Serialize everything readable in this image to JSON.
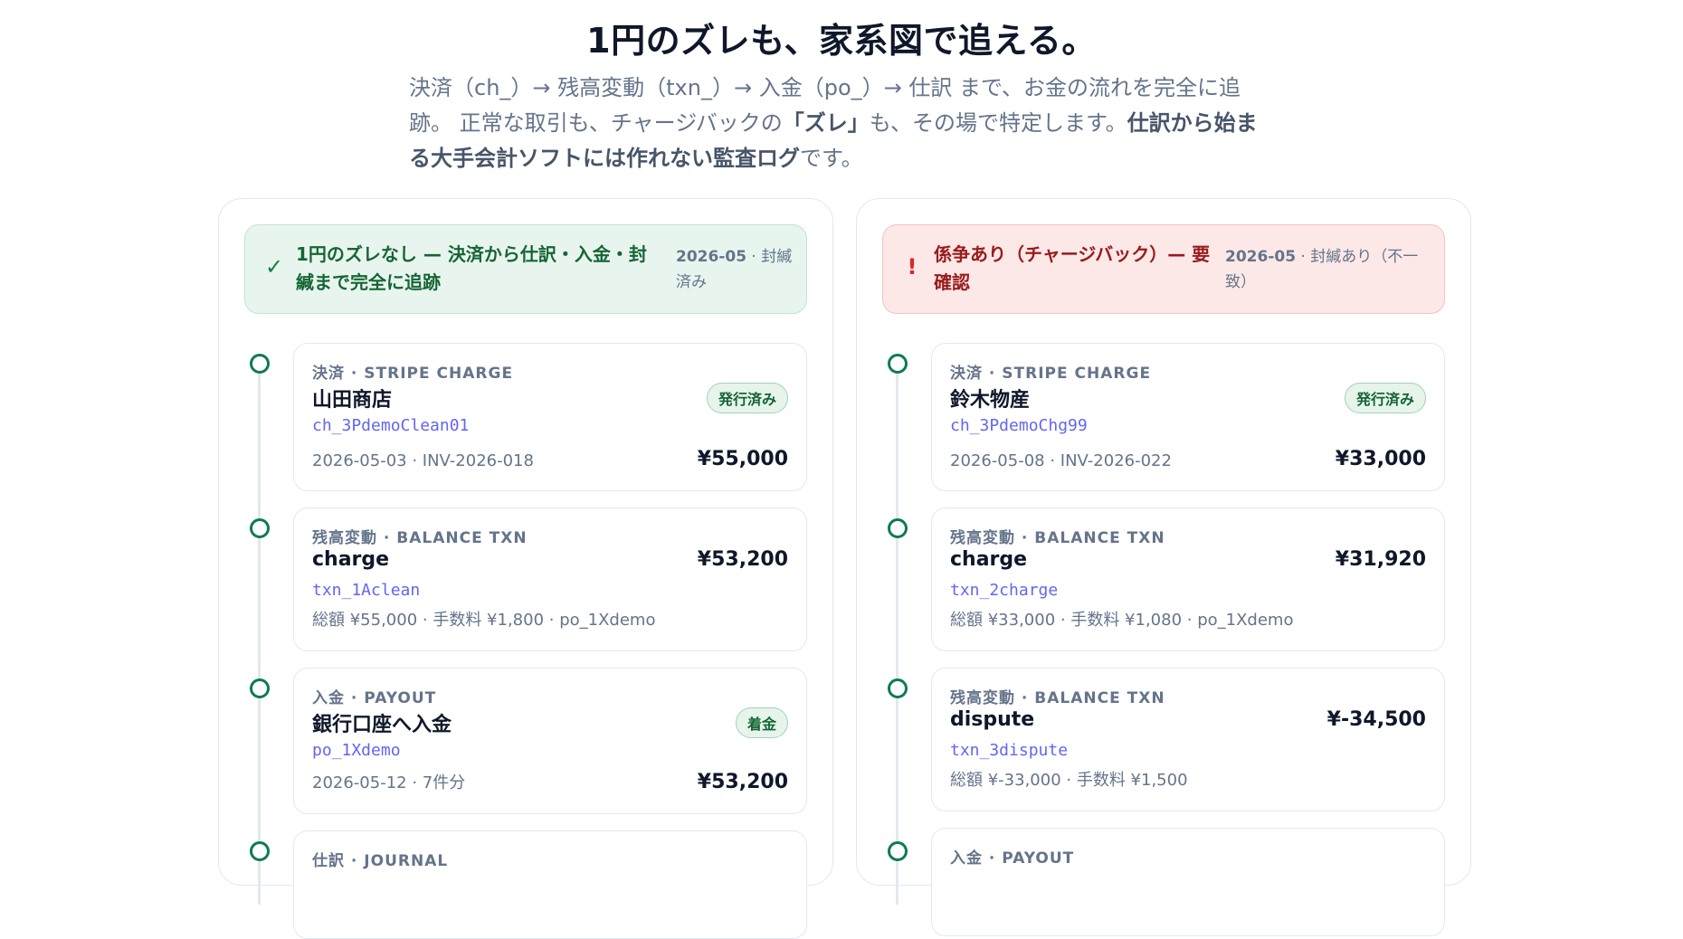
{
  "hero": {
    "title": "1円のズレも、家系図で追える。",
    "lead_1": "決済（ch_）→ 残高変動（txn_）→ 入金（po_）→ 仕訳 まで、お金の流れを完全に追跡。 正常な取引も、チャージバックの",
    "lead_2": "「ズレ」",
    "lead_3": "も、その場で特定します。",
    "lead_4": "仕訳から始まる大手会計ソフトには作れない監査ログ",
    "lead_5": "です。"
  },
  "colors": {
    "ok": "#166534",
    "bad": "#991b1b",
    "ref": "#6366f1",
    "dot": "#0f7a55"
  },
  "left": {
    "status_icon": "✓",
    "status_text": "1円のズレなし — 決済から仕訳・入金・封緘まで完全に追跡",
    "status_month": "2026-05",
    "status_state": " · 封緘済み",
    "cards": [
      {
        "kind": "決済 · STRIPE CHARGE",
        "name": "山田商店",
        "ref": "ch_3PdemoClean01",
        "sub": "2026-05-03 · INV-2026-018",
        "amount": "¥55,000",
        "badge": "発行済み"
      },
      {
        "kind": "残高変動 · BALANCE TXN",
        "name": "charge",
        "ref": "txn_1Aclean",
        "sub": "総額 ¥55,000 · 手数料 ¥1,800 · po_1Xdemo",
        "amount": "¥53,200"
      },
      {
        "kind": "入金 · PAYOUT",
        "name": "銀行口座へ入金",
        "ref": "po_1Xdemo",
        "sub": "2026-05-12 · 7件分",
        "amount": "¥53,200",
        "badge": "着金"
      },
      {
        "kind": "仕訳 · JOURNAL"
      }
    ]
  },
  "right": {
    "status_icon": "!",
    "status_text": "係争あり（チャージバック）— 要確認",
    "status_month": "2026-05",
    "status_state": " · 封緘あり（不一致）",
    "cards": [
      {
        "kind": "決済 · STRIPE CHARGE",
        "name": "鈴木物産",
        "ref": "ch_3PdemoChg99",
        "sub": "2026-05-08 · INV-2026-022",
        "amount": "¥33,000",
        "badge": "発行済み"
      },
      {
        "kind": "残高変動 · BALANCE TXN",
        "name": "charge",
        "ref": "txn_2charge",
        "sub": "総額 ¥33,000 · 手数料 ¥1,080 · po_1Xdemo",
        "amount": "¥31,920"
      },
      {
        "kind": "残高変動 · BALANCE TXN",
        "name": "dispute",
        "ref": "txn_3dispute",
        "sub": "総額 ¥-33,000 · 手数料 ¥1,500",
        "amount": "¥-34,500"
      },
      {
        "kind": "入金 · PAYOUT"
      }
    ]
  }
}
